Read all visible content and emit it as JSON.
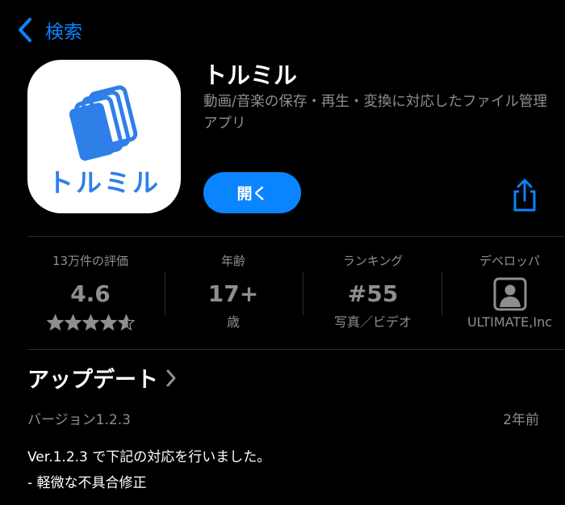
{
  "nav": {
    "back_label": "検索"
  },
  "app": {
    "name": "トルミル",
    "subtitle": "動画/音楽の保存・再生・変換に対応したファイル管理アプリ",
    "icon_text": "トルミル",
    "open_label": "開く",
    "brand_color": "#0a84ff",
    "icon_color": "#2e80e8"
  },
  "stats": {
    "ratings": {
      "header": "13万件の評価",
      "value": "4.6",
      "stars": 4.6
    },
    "age": {
      "header": "年齢",
      "value": "17+",
      "footer": "歳"
    },
    "ranking": {
      "header": "ランキング",
      "value": "#55",
      "footer": "写真／ビデオ"
    },
    "developer": {
      "header": "デベロッパ",
      "icon": "person-square-icon",
      "footer": "ULTIMATE,Inc"
    }
  },
  "update": {
    "title": "アップデート",
    "version": "バージョン1.2.3",
    "ago": "2年前",
    "notes": [
      "Ver.1.2.3 で下記の対応を行いました。",
      "- 軽微な不具合修正"
    ]
  }
}
